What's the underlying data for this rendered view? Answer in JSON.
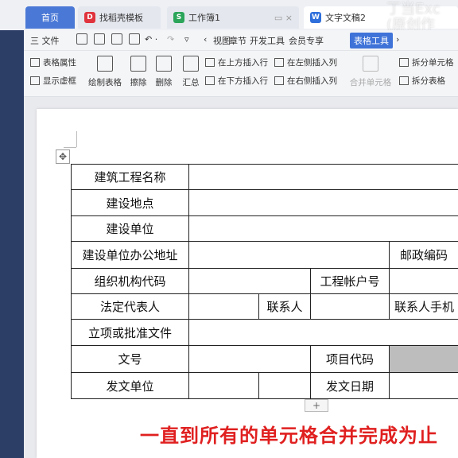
{
  "tabs": {
    "home": "首页",
    "template": "找稻壳模板",
    "workbook": "工作簿1",
    "document": "文字文稿2",
    "template_icon": "D",
    "workbook_icon": "S",
    "document_icon": "W"
  },
  "toolbar": {
    "file": "三 文件",
    "menu_items": [
      "视图",
      "章节",
      "开发工具",
      "会员专享"
    ],
    "active_tab": "表格工具",
    "nav_left": "‹",
    "nav_right": "›"
  },
  "ribbon": {
    "table_props": "表格属性",
    "show_gridlines": "显示虚框",
    "draw_table": "绘制表格",
    "erase": "擦除",
    "delete": "删除",
    "summary": "汇总",
    "insert_above": "在上方插入行",
    "insert_below": "在下方插入行",
    "insert_left": "在左侧插入列",
    "insert_right": "在右侧插入列",
    "merge_cells": "合并单元格",
    "split_cells": "拆分单元格",
    "split_table": "拆分表格"
  },
  "table": {
    "r1": "建筑工程名称",
    "r2": "建设地点",
    "r3": "建设单位",
    "r4": "建设单位办公地址",
    "r4_postcode": "邮政编码",
    "r5": "组织机构代码",
    "r5_account": "工程帐户号",
    "r6": "法定代表人",
    "r6_contact": "联系人",
    "r6_phone": "联系人手机",
    "r7": "立项或批准文件",
    "r8": "文号",
    "r8_code": "项目代码",
    "r9": "发文单位",
    "r9_date": "发文日期"
  },
  "caption": "一直到所有的单元格合并完成为止",
  "watermark": "丁当Exc\n(原创作",
  "colors": {
    "accent": "#3f73d8",
    "caption": "#e02020",
    "home_tab": "#4a78d6"
  }
}
